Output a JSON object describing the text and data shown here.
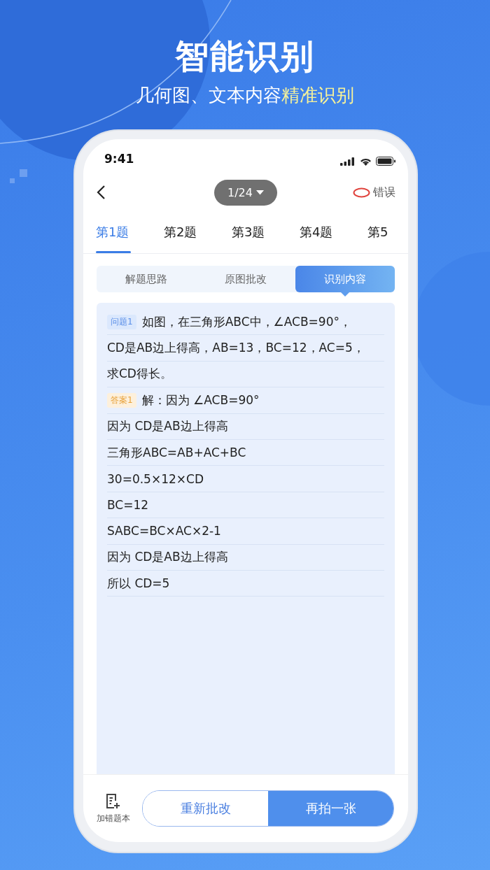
{
  "headline": {
    "title": "智能识别",
    "subtitle": "几何图、文本内容",
    "subtitle_highlight": "精准识别"
  },
  "status_bar": {
    "time": "9:41"
  },
  "nav": {
    "pager": "1/24",
    "error_label": "错误"
  },
  "tabs": [
    {
      "label": "第1题",
      "selected": true
    },
    {
      "label": "第2题",
      "selected": false
    },
    {
      "label": "第3题",
      "selected": false
    },
    {
      "label": "第4题",
      "selected": false
    },
    {
      "label": "第5",
      "selected": false
    }
  ],
  "segments": [
    {
      "label": "解题思路",
      "selected": false
    },
    {
      "label": "原图批改",
      "selected": false
    },
    {
      "label": "识别内容",
      "selected": true
    }
  ],
  "lines": [
    {
      "tag": {
        "label": "问题1",
        "kind": "question"
      },
      "text": "如图，在三角形ABC中，∠ACB=90°，"
    },
    {
      "text": "CD是AB边上得高，AB=13，BC=12，AC=5，"
    },
    {
      "text": "求CD得长。"
    },
    {
      "tag": {
        "label": "答案1",
        "kind": "answer"
      },
      "text": "解：因为 ∠ACB=90°"
    },
    {
      "text": "因为 CD是AB边上得高"
    },
    {
      "text": "三角形ABC=AB+AC+BC"
    },
    {
      "text": "30=0.5×12×CD"
    },
    {
      "text": "BC=12"
    },
    {
      "text": "SABC=BC×AC×2-1"
    },
    {
      "text": "因为 CD是AB边上得高"
    },
    {
      "text": "所以 CD=5"
    }
  ],
  "bottom_bar": {
    "add_label": "加错题本",
    "buttons": [
      {
        "label": "重新批改",
        "kind": "outline"
      },
      {
        "label": "再拍一张",
        "kind": "filled"
      }
    ]
  }
}
